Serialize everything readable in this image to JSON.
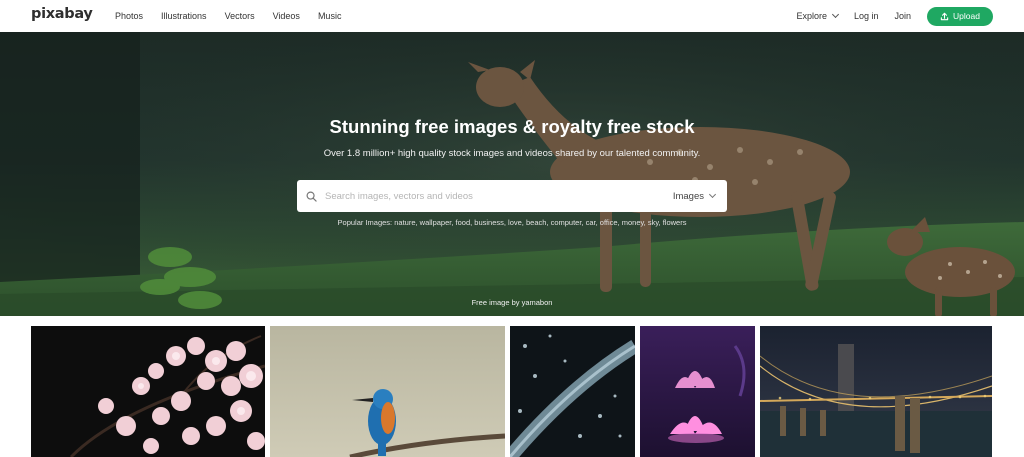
{
  "logo": "pixabay",
  "nav": {
    "links": [
      "Photos",
      "Illustrations",
      "Vectors",
      "Videos",
      "Music"
    ],
    "explore": "Explore",
    "login": "Log in",
    "join": "Join",
    "upload": "Upload"
  },
  "hero": {
    "title": "Stunning free images & royalty free stock",
    "subtitle": "Over 1.8 million+ high quality stock images and videos shared by our talented community.",
    "search_placeholder": "Search images, vectors and videos",
    "search_type": "Images",
    "popular": "Popular Images: nature, wallpaper, food, business, love, beach, computer, car, office, money, sky, flowers",
    "credit": "Free image by yamabon"
  },
  "colors": {
    "accent": "#1fa862",
    "nav_text": "#333333"
  },
  "icons": {
    "search": "search-icon",
    "upload": "upload-icon",
    "explore_chevron": "chevron-down-icon"
  },
  "gallery": [
    {
      "name": "cherry-blossom-photo"
    },
    {
      "name": "kingfisher-photo"
    },
    {
      "name": "rain-railing-photo"
    },
    {
      "name": "lotus-flowers-photo"
    },
    {
      "name": "brooklyn-bridge-photo"
    }
  ]
}
